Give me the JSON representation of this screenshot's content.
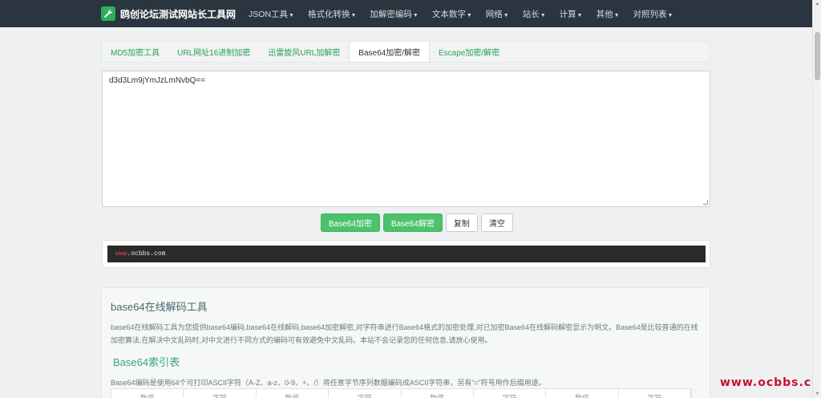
{
  "navbar": {
    "brand": "鸥创论坛测试网站长工具网",
    "brand_icon": "wrench-icon",
    "items": [
      {
        "label": "JSON工具"
      },
      {
        "label": "格式化转换"
      },
      {
        "label": "加解密编码"
      },
      {
        "label": "文本数字"
      },
      {
        "label": "网络"
      },
      {
        "label": "站长"
      },
      {
        "label": "计算"
      },
      {
        "label": "其他"
      },
      {
        "label": "对照列表"
      }
    ],
    "background": "#2b3540"
  },
  "tabs": [
    {
      "label": "MD5加密工具"
    },
    {
      "label": "URL网址16进制加密"
    },
    {
      "label": "迅雷旋风URL加解密"
    },
    {
      "label": "Base64加密/解密",
      "active": true
    },
    {
      "label": "Escape加密/解密"
    }
  ],
  "editor": {
    "value": "d3d3Lm9jYmJzLmNvbQ=="
  },
  "buttons": {
    "encode": "Base64加密",
    "decode": "Base64解密",
    "copy": "复制",
    "clear": "清空"
  },
  "output": {
    "prefix": "www",
    "rest": ".ocbbs.com"
  },
  "info": {
    "title": "base64在线解码工具",
    "text": "base64在线解码工具为您提供base64编码,base64在线解码,base64加密解密,对字符串进行Base64格式的加密处理,对已加密Base64在线解码解密显示为明文。Base64是比较普通的在线加密算法,在解决中文乱码时,对中文进行不同方式的编码可有效避免中文乱码。本站不会记录您的任何信息,请放心使用。",
    "subtitle": "Base64索引表",
    "text2": "Base64编码是使用64个可打印ASCII字符（A-Z、a-z、0-9、+、/）将任意字节序列数据编码成ASCII字符串，另有“=”符号用作后缀用途。",
    "table_headers": [
      "数值",
      "字符",
      "数值",
      "字符",
      "数值",
      "字符",
      "数值",
      "字符"
    ]
  },
  "watermark": "www.ocbbs.com",
  "colors": {
    "accent": "#4cc26c",
    "link": "#2aa154",
    "watermark": "#c8102e"
  }
}
